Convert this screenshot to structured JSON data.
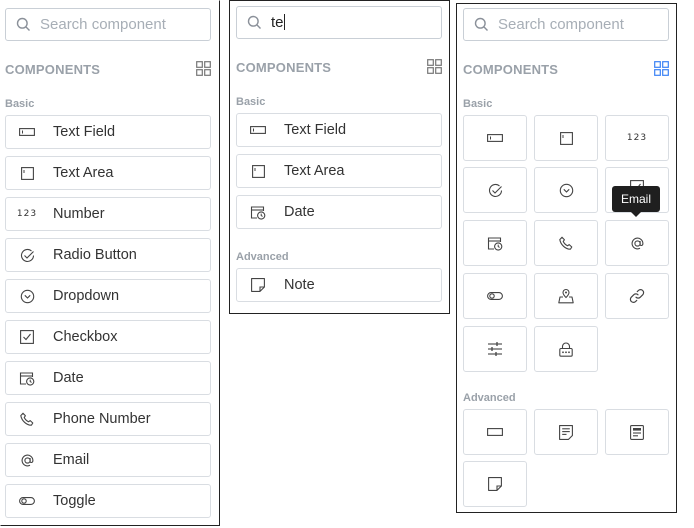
{
  "panel_full": {
    "search_placeholder": "Search component",
    "header": "COMPONENTS",
    "groups": [
      {
        "label": "Basic",
        "items": [
          {
            "label": "Text Field",
            "icon": "text-field-icon"
          },
          {
            "label": "Text Area",
            "icon": "text-area-icon"
          },
          {
            "label": "Number",
            "icon": "number-icon",
            "icon_text": "123"
          },
          {
            "label": "Radio Button",
            "icon": "radio-check-icon"
          },
          {
            "label": "Dropdown",
            "icon": "dropdown-icon"
          },
          {
            "label": "Checkbox",
            "icon": "checkbox-icon"
          },
          {
            "label": "Date",
            "icon": "date-icon"
          },
          {
            "label": "Phone Number",
            "icon": "phone-icon"
          },
          {
            "label": "Email",
            "icon": "at-icon"
          },
          {
            "label": "Toggle",
            "icon": "toggle-icon"
          }
        ]
      }
    ]
  },
  "panel_search": {
    "search_value": "te",
    "header": "COMPONENTS",
    "groups": [
      {
        "label": "Basic",
        "items": [
          {
            "label": "Text Field",
            "icon": "text-field-icon"
          },
          {
            "label": "Text Area",
            "icon": "text-area-icon"
          },
          {
            "label": "Date",
            "icon": "date-icon"
          }
        ]
      },
      {
        "label": "Advanced",
        "items": [
          {
            "label": "Note",
            "icon": "note-icon"
          }
        ]
      }
    ]
  },
  "panel_grid": {
    "search_placeholder": "Search component",
    "header": "COMPONENTS",
    "accent_color": "#3b82f6",
    "basic_label": "Basic",
    "advanced_label": "Advanced",
    "tooltip": "Email",
    "number_icon_text": "123"
  }
}
